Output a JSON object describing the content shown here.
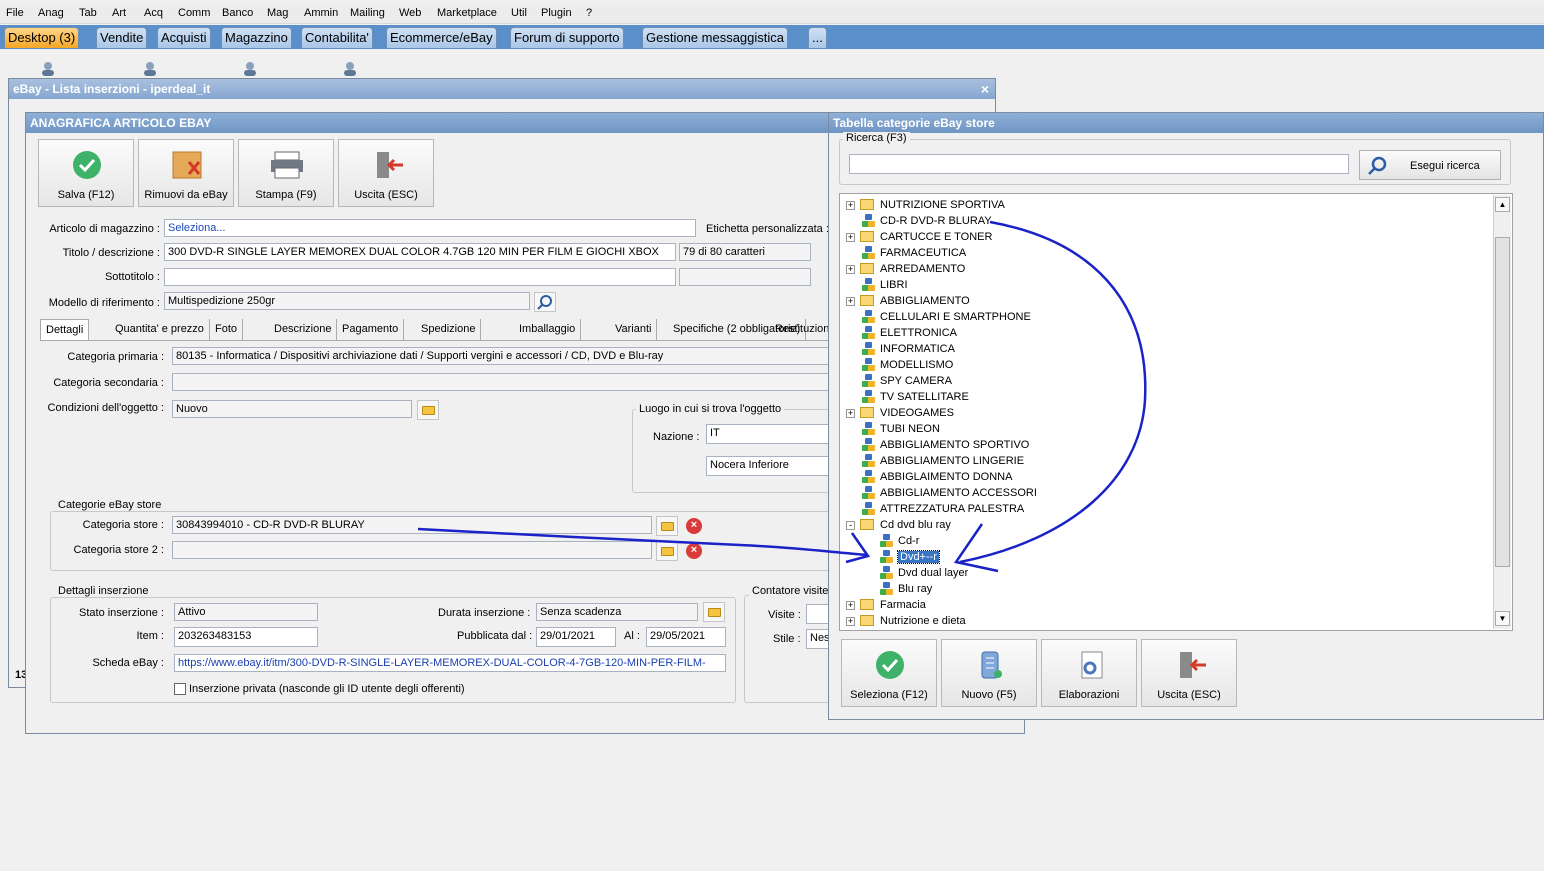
{
  "menu": [
    "File",
    "Anag",
    "Tab",
    "Art",
    "Acq",
    "Comm",
    "Banco",
    "Mag",
    "Ammin",
    "Mailing",
    "Web",
    "Marketplace",
    "Util",
    "Plugin",
    "?"
  ],
  "tabs": [
    "Desktop (3)",
    "Vendite",
    "Acquisti",
    "Magazzino",
    "Contabilita'",
    "Ecommerce/eBay",
    "Forum di supporto",
    "Gestione messaggistica",
    "..."
  ],
  "list_window": {
    "title": "eBay - Lista inserzioni - iperdeal_it",
    "close": "×",
    "status_num": "13"
  },
  "article": {
    "title": "ANAGRAFICA ARTICOLO EBAY",
    "buttons": {
      "save": "Salva (F12)",
      "remove": "Rimuovi da eBay",
      "print": "Stampa (F9)",
      "exit": "Uscita (ESC)"
    },
    "labels": {
      "articolo": "Articolo di magazzino :",
      "etichetta": "Etichetta personalizzata :",
      "titolo": "Titolo / descrizione :",
      "sottotitolo": "Sottotitolo :",
      "modello": "Modello di riferimento :"
    },
    "values": {
      "articolo": "Seleziona...",
      "titolo": "300 DVD-R SINGLE LAYER  MEMOREX DUAL COLOR 4.7GB 120 MIN PER FILM E GIOCHI XBOX",
      "counter": "79 di 80 caratteri",
      "sottotitolo": "",
      "modello": "Multispedizione 250gr"
    },
    "inner_tabs": [
      "Dettagli",
      "Quantita' e prezzo",
      "Foto",
      "Descrizione",
      "Pagamento",
      "Spedizione",
      "Imballaggio",
      "Varianti",
      "Specifiche (2 obbligatorie)",
      "Restituzion"
    ],
    "details": {
      "cat_primaria_label": "Categoria primaria :",
      "cat_primaria": "80135 - Informatica / Dispositivi archiviazione dati / Supporti vergini e accessori / CD, DVD e Blu-ray",
      "cat_secondaria_label": "Categoria secondaria :",
      "cat_secondaria": "",
      "condizioni_label": "Condizioni dell'oggetto :",
      "condizioni": "Nuovo",
      "luogo_group": "Luogo in cui si trova l'oggetto",
      "nazione_label": "Nazione :",
      "nazione": "IT",
      "citta": "Nocera Inferiore",
      "store_group": "Categorie eBay store",
      "store1_label": "Categoria store :",
      "store1": "30843994010 - CD-R DVD-R BLURAY",
      "store2_label": "Categoria store 2 :",
      "store2": "",
      "ins_group": "Dettagli inserzione",
      "stato_label": "Stato inserzione :",
      "stato": "Attivo",
      "durata_label": "Durata inserzione :",
      "durata": "Senza scadenza",
      "item_label": "Item :",
      "item": "203263483153",
      "pubblicata_label": "Pubblicata dal :",
      "pubblicata": "29/01/2021",
      "al_label": "Al :",
      "al": "29/05/2021",
      "scheda_label": "Scheda eBay :",
      "scheda": "https://www.ebay.it/itm/300-DVD-R-SINGLE-LAYER-MEMOREX-DUAL-COLOR-4-7GB-120-MIN-PER-FILM-",
      "privata": "Inserzione privata (nasconde gli ID utente degli offerenti)",
      "contatore_group": "Contatore visite",
      "visite_label": "Visite :",
      "stile_label": "Stile :",
      "stile": "Ness"
    }
  },
  "category_window": {
    "title": "Tabella categorie eBay store",
    "search_group": "Ricerca (F3)",
    "search_value": "",
    "search_button": "Esegui ricerca",
    "tree": [
      {
        "label": "NUTRIZIONE SPORTIVA",
        "kind": "folder",
        "expand": "+",
        "level": 0
      },
      {
        "label": "CD-R DVD-R BLURAY",
        "kind": "node",
        "expand": "",
        "level": 0
      },
      {
        "label": "CARTUCCE E TONER",
        "kind": "folder",
        "expand": "+",
        "level": 0
      },
      {
        "label": "FARMACEUTICA",
        "kind": "node",
        "expand": "",
        "level": 0
      },
      {
        "label": "ARREDAMENTO",
        "kind": "folder",
        "expand": "+",
        "level": 0
      },
      {
        "label": "LIBRI",
        "kind": "node",
        "expand": "",
        "level": 0
      },
      {
        "label": "ABBIGLIAMENTO",
        "kind": "folder",
        "expand": "+",
        "level": 0
      },
      {
        "label": "CELLULARI E SMARTPHONE",
        "kind": "node",
        "expand": "",
        "level": 0
      },
      {
        "label": "ELETTRONICA",
        "kind": "node",
        "expand": "",
        "level": 0
      },
      {
        "label": "INFORMATICA",
        "kind": "node",
        "expand": "",
        "level": 0
      },
      {
        "label": "MODELLISMO",
        "kind": "node",
        "expand": "",
        "level": 0
      },
      {
        "label": "SPY CAMERA",
        "kind": "node",
        "expand": "",
        "level": 0
      },
      {
        "label": "TV SATELLITARE",
        "kind": "node",
        "expand": "",
        "level": 0
      },
      {
        "label": "VIDEOGAMES",
        "kind": "folder",
        "expand": "+",
        "level": 0
      },
      {
        "label": "TUBI NEON",
        "kind": "node",
        "expand": "",
        "level": 0
      },
      {
        "label": "ABBIGLIAMENTO SPORTIVO",
        "kind": "node",
        "expand": "",
        "level": 0
      },
      {
        "label": "ABBIGLIAMENTO LINGERIE",
        "kind": "node",
        "expand": "",
        "level": 0
      },
      {
        "label": "ABBIGLAIMENTO DONNA",
        "kind": "node",
        "expand": "",
        "level": 0
      },
      {
        "label": "ABBIGLIAMENTO ACCESSORI",
        "kind": "node",
        "expand": "",
        "level": 0
      },
      {
        "label": "ATTREZZATURA PALESTRA",
        "kind": "node",
        "expand": "",
        "level": 0
      },
      {
        "label": "Cd dvd blu ray",
        "kind": "folder",
        "expand": "-",
        "level": 0
      },
      {
        "label": "Cd-r",
        "kind": "node",
        "expand": "",
        "level": 1
      },
      {
        "label": "Dvd+--r",
        "kind": "node",
        "expand": "",
        "level": 1,
        "selected": true
      },
      {
        "label": "Dvd dual layer",
        "kind": "node",
        "expand": "",
        "level": 1
      },
      {
        "label": "Blu ray",
        "kind": "node",
        "expand": "",
        "level": 1
      },
      {
        "label": "Farmacia",
        "kind": "folder",
        "expand": "+",
        "level": 0
      },
      {
        "label": "Nutrizione e dieta",
        "kind": "folder",
        "expand": "+",
        "level": 0
      }
    ],
    "buttons": {
      "select": "Seleziona (F12)",
      "new": "Nuovo (F5)",
      "process": "Elaborazioni",
      "exit": "Uscita (ESC)"
    }
  },
  "colors": {
    "tabbar": "#5b8fc9",
    "active_tab": "#f5a623",
    "annotation": "#1a22c8",
    "title_bar": "#7a9ccc"
  }
}
